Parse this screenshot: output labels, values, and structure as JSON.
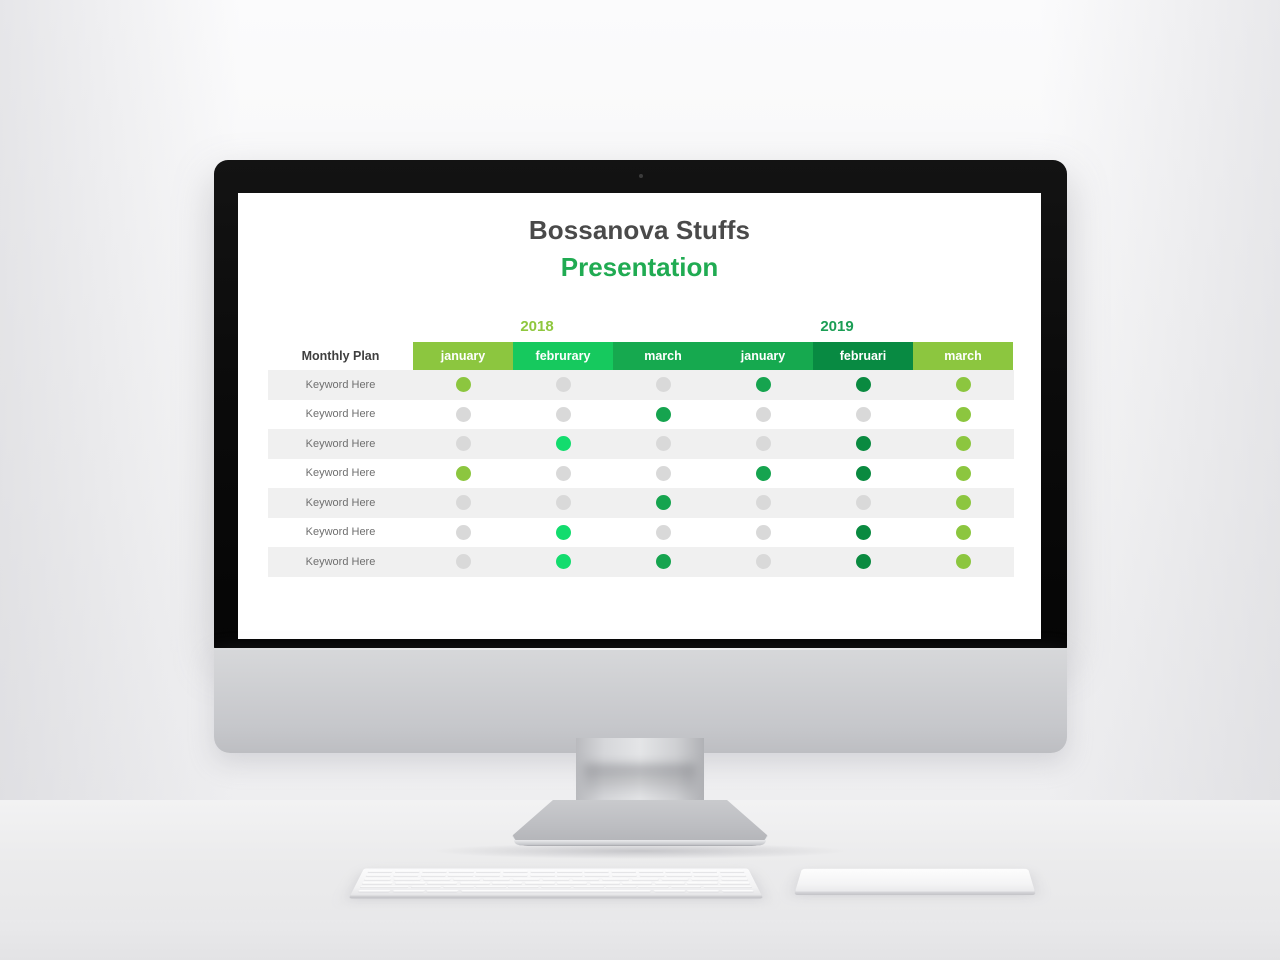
{
  "scene": {
    "device": "imac-desktop-monitor",
    "peripherals": [
      "magic-keyboard",
      "magic-trackpad"
    ]
  },
  "slide": {
    "title_main": "Bossanova Stuffs",
    "title_sub": "Presentation",
    "title_main_color": "#4a4a4a",
    "title_sub_color": "#20ab52"
  },
  "chart_data": {
    "type": "heatmap",
    "title": "Bossanova Stuffs Presentation",
    "row_header_label": "Monthly Plan",
    "group_headers": [
      {
        "label": "2018",
        "color": "#8fc73e",
        "span": 3
      },
      {
        "label": "2019",
        "color": "#1b9e55",
        "span": 3
      }
    ],
    "categories": [
      "january",
      "februrary",
      "march",
      "january",
      "februari",
      "march"
    ],
    "column_colors": [
      "#8cc63f",
      "#16c95e",
      "#16a94f",
      "#16a94f",
      "#088a42",
      "#8cc63f"
    ],
    "rows": [
      {
        "label": "Keyword Here",
        "values": [
          "on-light",
          "off",
          "off",
          "on-mid",
          "on-dark",
          "on-light"
        ]
      },
      {
        "label": "Keyword Here",
        "values": [
          "off",
          "off",
          "on-mid",
          "off",
          "off",
          "on-light"
        ]
      },
      {
        "label": "Keyword Here",
        "values": [
          "off",
          "on-bright",
          "off",
          "off",
          "on-dark",
          "on-light"
        ]
      },
      {
        "label": "Keyword Here",
        "values": [
          "on-light",
          "off",
          "off",
          "on-mid",
          "on-dark",
          "on-light"
        ]
      },
      {
        "label": "Keyword Here",
        "values": [
          "off",
          "off",
          "on-mid",
          "off",
          "off",
          "on-light"
        ]
      },
      {
        "label": "Keyword Here",
        "values": [
          "off",
          "on-bright",
          "off",
          "off",
          "on-dark",
          "on-light"
        ]
      },
      {
        "label": "Keyword Here",
        "values": [
          "off",
          "on-bright",
          "on-mid",
          "off",
          "on-dark",
          "on-light"
        ]
      }
    ],
    "state_colors": {
      "off": "#d9d9d9",
      "on-light": "#8cc63f",
      "on-bright": "#13dc6e",
      "on-mid": "#16a44f",
      "on-dark": "#0a8a40"
    },
    "alt_row_background": "#f0f0f0",
    "legend": "none",
    "grid": false
  }
}
